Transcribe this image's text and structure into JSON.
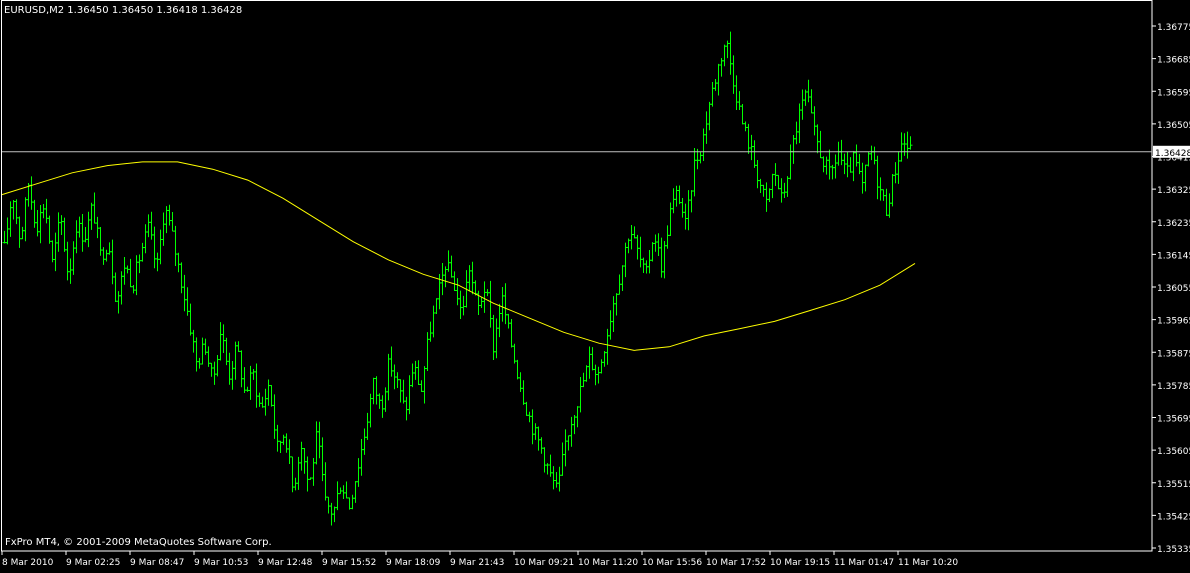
{
  "header": {
    "symbol_info": "EURUSD,M2  1.36450 1.36450 1.36418 1.36428"
  },
  "footer": {
    "copyright": "FxPro MT4, © 2001-2009 MetaQuotes Software Corp."
  },
  "colors": {
    "background": "#000000",
    "axis": "#ffffff",
    "bars": "#00ff00",
    "moving_average": "#ffff00",
    "price_line": "#c0c0c0",
    "price_label_bg": "#ffffff",
    "price_label_text": "#000000"
  },
  "chart_data": {
    "type": "ohlc",
    "symbol": "EURUSD",
    "timeframe": "M2",
    "ylim": [
      1.3533,
      1.3681
    ],
    "y_ticks": [
      "1.36775",
      "1.36685",
      "1.36595",
      "1.36505",
      "1.36415",
      "1.36325",
      "1.36235",
      "1.36145",
      "1.36055",
      "1.35965",
      "1.35875",
      "1.35785",
      "1.35695",
      "1.35605",
      "1.35515",
      "1.35425",
      "1.35335"
    ],
    "x_ticks": [
      "8 Mar 2010",
      "9 Mar 02:25",
      "9 Mar 08:47",
      "9 Mar 10:53",
      "9 Mar 12:48",
      "9 Mar 15:52",
      "9 Mar 18:09",
      "9 Mar 21:43",
      "10 Mar 09:21",
      "10 Mar 11:20",
      "10 Mar 15:56",
      "10 Mar 17:52",
      "10 Mar 19:15",
      "11 Mar 01:47",
      "11 Mar 10:20"
    ],
    "current_price": "1.36428",
    "price_path": [
      1.3616,
      1.3632,
      1.3618,
      1.3634,
      1.3622,
      1.3629,
      1.3612,
      1.3625,
      1.3608,
      1.3623,
      1.3619,
      1.3628,
      1.3614,
      1.3618,
      1.3601,
      1.3612,
      1.3606,
      1.3615,
      1.3622,
      1.361,
      1.3628,
      1.3619,
      1.3608,
      1.3597,
      1.3584,
      1.359,
      1.3579,
      1.3594,
      1.3581,
      1.3589,
      1.3576,
      1.3582,
      1.3571,
      1.3579,
      1.3561,
      1.3566,
      1.3549,
      1.3563,
      1.355,
      1.3565,
      1.3546,
      1.3543,
      1.3552,
      1.3545,
      1.3555,
      1.3566,
      1.3579,
      1.3572,
      1.3585,
      1.3579,
      1.3571,
      1.3584,
      1.3577,
      1.3593,
      1.3602,
      1.3612,
      1.3607,
      1.3598,
      1.3611,
      1.3599,
      1.3606,
      1.3589,
      1.3603,
      1.3592,
      1.3582,
      1.3573,
      1.3566,
      1.3561,
      1.3554,
      1.3549,
      1.3563,
      1.3571,
      1.3578,
      1.3586,
      1.3581,
      1.3591,
      1.3602,
      1.3611,
      1.3622,
      1.3615,
      1.3608,
      1.3621,
      1.3611,
      1.3626,
      1.3632,
      1.3622,
      1.3639,
      1.3645,
      1.3657,
      1.3666,
      1.3674,
      1.3662,
      1.3651,
      1.3644,
      1.3636,
      1.3628,
      1.3638,
      1.3629,
      1.3641,
      1.3652,
      1.3659,
      1.3648,
      1.3641,
      1.3636,
      1.3643,
      1.3636,
      1.3641,
      1.3633,
      1.3644,
      1.3634,
      1.3627,
      1.3637,
      1.3646,
      1.3643
    ],
    "moving_average": [
      1.3631,
      1.3634,
      1.3637,
      1.3639,
      1.364,
      1.364,
      1.3638,
      1.3635,
      1.363,
      1.3624,
      1.3618,
      1.3613,
      1.3609,
      1.3606,
      1.3601,
      1.3597,
      1.3593,
      1.359,
      1.3588,
      1.3589,
      1.3592,
      1.3594,
      1.3596,
      1.3599,
      1.3602,
      1.3606,
      1.3612
    ]
  }
}
